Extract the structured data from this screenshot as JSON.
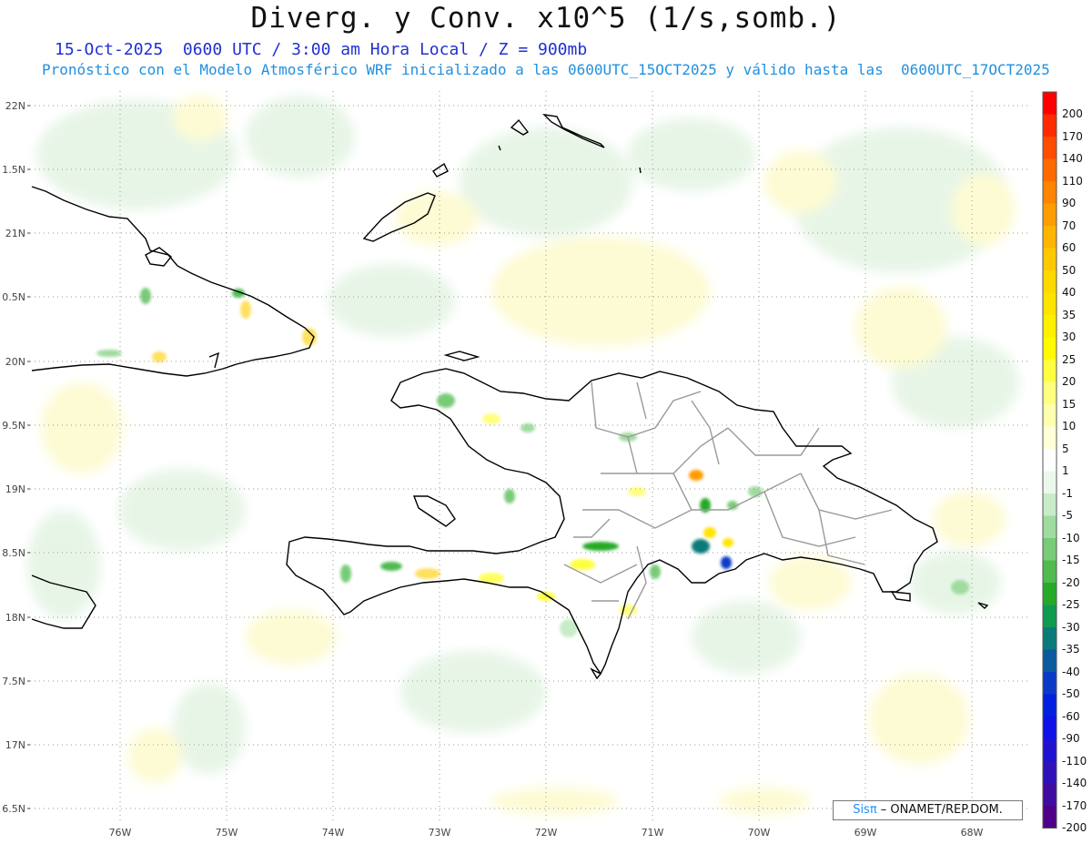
{
  "title": "Diverg. y Conv. x10^5 (1/s,somb.)",
  "subtitle_line1": "15-Oct-2025  0600 UTC / 3:00 am Hora Local / Z = 900mb",
  "subtitle_line2": "Pronóstico con el Modelo Atmosférico WRF inicializado a las 0600UTC_15OCT2025 y válido hasta las  0600UTC_17OCT2025",
  "lat_labels": [
    "22N",
    "1.5N",
    "21N",
    "0.5N",
    "20N",
    "9.5N",
    "19N",
    "8.5N",
    "18N",
    "7.5N",
    "17N",
    "6.5N"
  ],
  "lon_labels": [
    "76W",
    "75W",
    "74W",
    "73W",
    "72W",
    "71W",
    "70W",
    "69W",
    "68W"
  ],
  "colorbar": {
    "labels": [
      "200",
      "170",
      "140",
      "110",
      "90",
      "70",
      "60",
      "50",
      "40",
      "35",
      "30",
      "25",
      "20",
      "15",
      "10",
      "5",
      "1",
      "-1",
      "-5",
      "-10",
      "-15",
      "-20",
      "-25",
      "-30",
      "-35",
      "-40",
      "-50",
      "-60",
      "-90",
      "-110",
      "-140",
      "-170",
      "-200"
    ],
    "colors": [
      "#ff0000",
      "#ff2a00",
      "#ff4c00",
      "#ff6a00",
      "#ff8400",
      "#ff9c00",
      "#ffb400",
      "#ffc800",
      "#ffd800",
      "#ffe400",
      "#fff000",
      "#fffa00",
      "#ffff40",
      "#ffff80",
      "#ffffb0",
      "#ffffd8",
      "#ffffff",
      "#ecf8ec",
      "#c8ecc8",
      "#a0dca0",
      "#78cc78",
      "#50bc50",
      "#28aa28",
      "#109a50",
      "#0a7a7a",
      "#0a5aa0",
      "#0a3ac8",
      "#0020e0",
      "#1010e8",
      "#2010d0",
      "#3010b8",
      "#400ca0",
      "#500088"
    ]
  },
  "credit_brand": "Sisπ",
  "credit_text": " – ONAMET/REP.DOM."
}
